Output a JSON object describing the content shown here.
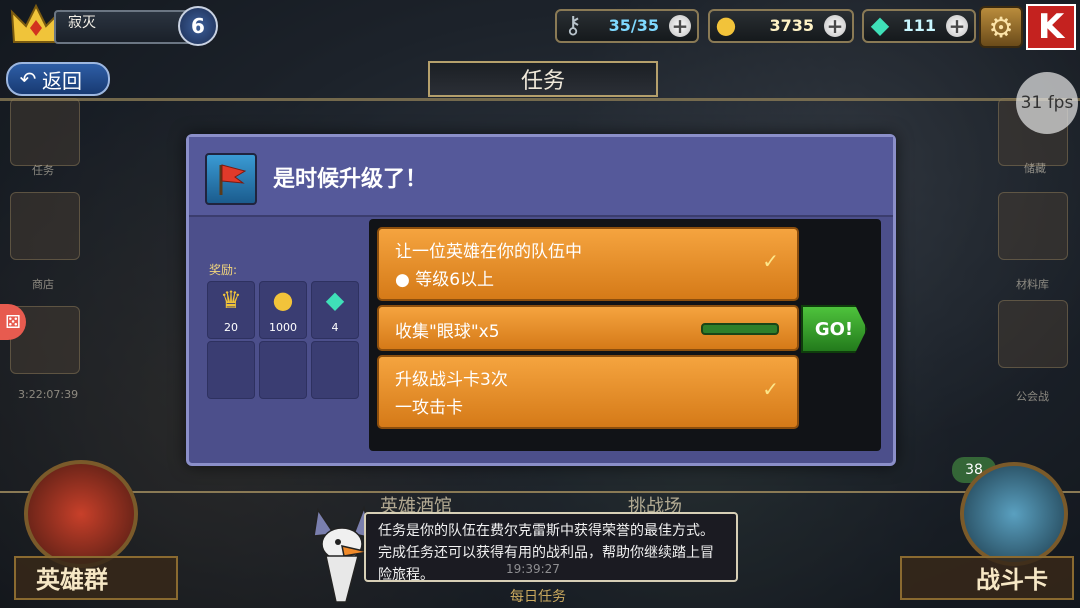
{
  "player": {
    "name": "寂灭",
    "level": "6"
  },
  "resources": {
    "energy": {
      "icon": "key-icon",
      "value": "35/35"
    },
    "gold": {
      "icon": "coin-icon",
      "value": "3735"
    },
    "gems": {
      "icon": "gem-icon",
      "value": "111"
    }
  },
  "nav": {
    "back_label": "返回",
    "title": "任务",
    "k_label": "K"
  },
  "fps": "31 fps",
  "side": {
    "left": [
      {
        "label": "任务"
      },
      {
        "label": "商店"
      },
      {
        "label": "3:22:07:39"
      }
    ],
    "right": [
      {
        "label": "储藏"
      },
      {
        "label": "材料库"
      },
      {
        "label": "公会战"
      }
    ]
  },
  "dialog": {
    "title": "是时候升级了！",
    "rewards_label": "奖励:",
    "rewards": [
      {
        "icon": "crown-icon",
        "value": "20"
      },
      {
        "icon": "coin-icon",
        "value": "1000"
      },
      {
        "icon": "gem-icon",
        "value": "4"
      }
    ],
    "quests": [
      {
        "line1": "让一位英雄在你的队伍中",
        "line2": "● 等级6以上",
        "done": true
      },
      {
        "line1": "收集\"眼球\"x5",
        "line2": "",
        "done": false,
        "progress": 1.0
      },
      {
        "line1": "升级战斗卡3次",
        "line2": "一攻击卡",
        "done": true
      }
    ],
    "go_label": "GO!"
  },
  "bottom": {
    "left_label": "英雄群",
    "right_label": "战斗卡",
    "mid_left": "英雄酒馆",
    "mid_right": "挑战场",
    "badge": "38",
    "timer": "19:39:27",
    "daily": "每日任务",
    "speech": "任务是你的队伍在费尔克雷斯中获得荣誉的最佳方式。完成任务还可以获得有用的战利品，帮助你继续踏上冒险旅程。"
  },
  "colors": {
    "dialog_bg": "#4c4f8b",
    "quest_orange": "#f5a43f",
    "go_green": "#4ec33c",
    "k_red": "#c4221f"
  }
}
